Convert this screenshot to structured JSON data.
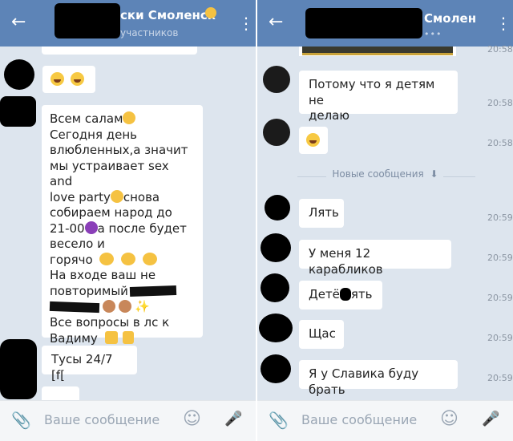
{
  "left": {
    "header": {
      "title": "ски Смоленск",
      "subtitle": "участников"
    },
    "messages": [
      {
        "text": "Всем салам"
      },
      {
        "text": "Сегодня день"
      },
      {
        "text": "влюбленных,а значит"
      },
      {
        "text": "мы устраивает sex and"
      },
      {
        "text": "love party"
      },
      {
        "text": "снова"
      },
      {
        "text": "собираем народ до"
      },
      {
        "text": "21-00"
      },
      {
        "text": "а после будет"
      },
      {
        "text": "весело и"
      },
      {
        "text": "горячо"
      },
      {
        "text": "На входе ваш не"
      },
      {
        "text": "повторимый"
      },
      {
        "text": "Все вопросы в лс к"
      },
      {
        "text": "Вадиму"
      }
    ],
    "tusy": "Тусы 24/7 [f["
  },
  "right": {
    "header": {
      "title": "Смолен",
      "subtitle": "•••"
    },
    "top_time": "20:58",
    "messages": [
      {
        "line1": "Потому что я детям не",
        "line2": "делаю",
        "time": "20:58"
      },
      {
        "line1": "",
        "line2": "",
        "time": "20:58"
      }
    ],
    "new_messages_label": "Новые сообщения",
    "new_messages_arrow": "⬇",
    "unread": [
      {
        "text": "Лять",
        "time": "20:59"
      },
      {
        "text": "У меня 12 карабликов",
        "time": "20:59"
      },
      {
        "text_a": "Детё",
        "text_b": "ять",
        "time": "20:59"
      },
      {
        "text": "Щас",
        "time": "20:59"
      },
      {
        "text": "Я у Славика буду брать",
        "time": "20:59"
      }
    ]
  },
  "composer": {
    "placeholder": "Ваше сообщение"
  },
  "icons": {
    "back": "arrow-left-icon",
    "menu": "kebab-icon",
    "attach": "paperclip-icon",
    "emoji": "smile-icon",
    "mic": "microphone-icon"
  },
  "colors": {
    "header": "#5d84b7",
    "chat_bg": "#dde5ee",
    "bubble": "#ffffff"
  }
}
